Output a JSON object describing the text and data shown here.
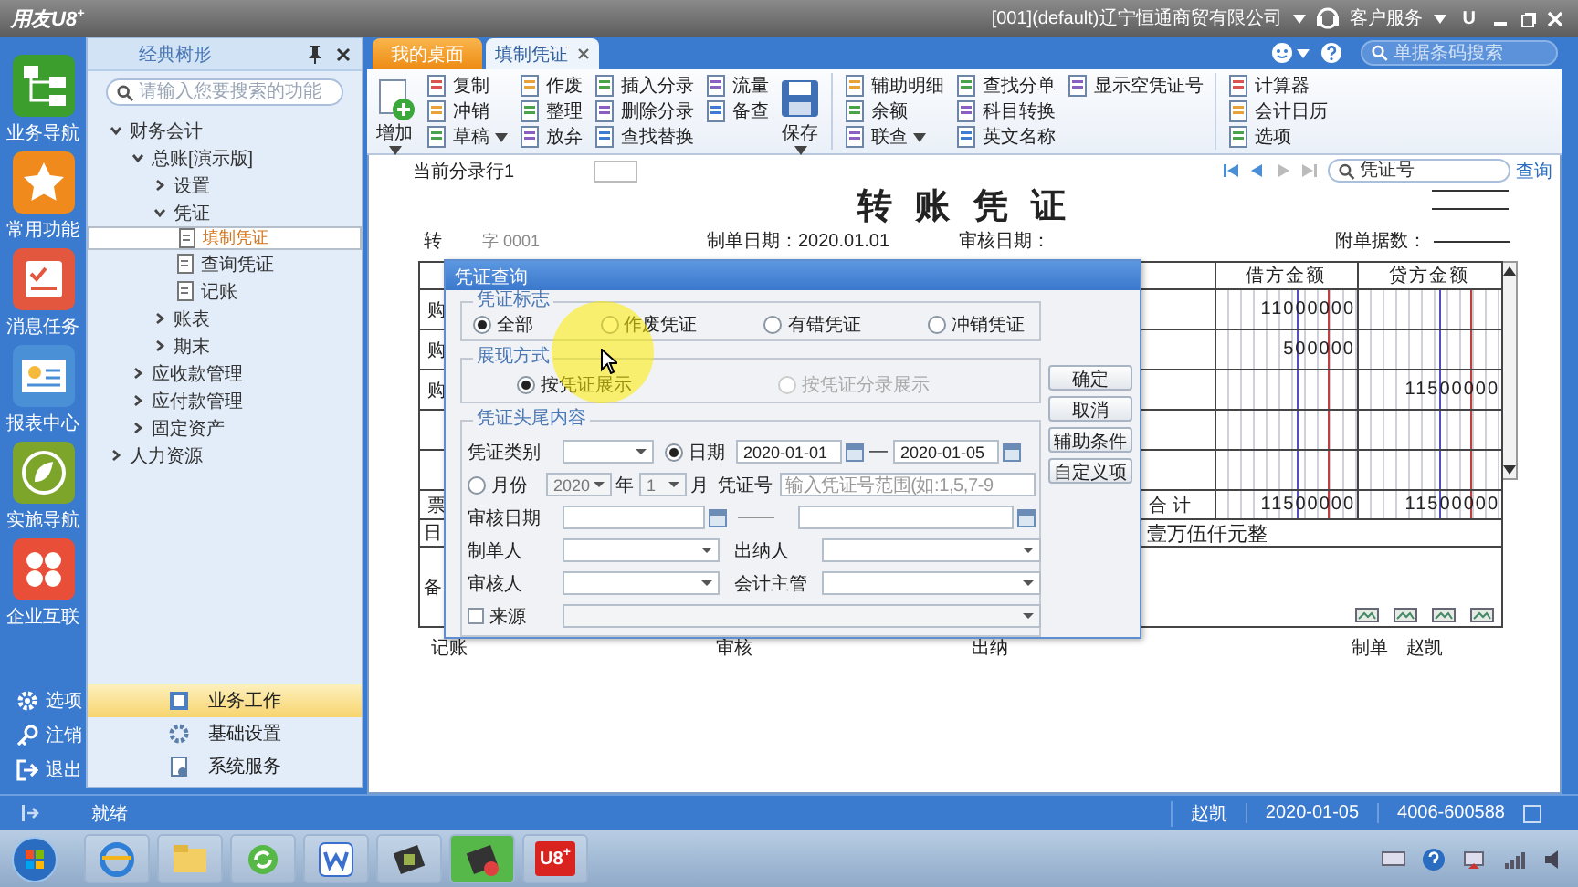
{
  "title_bar": {
    "app_name": "用友U8$^{+}$",
    "company": "[001](default)辽宁恒通商贸有限公司",
    "service": "客户服务",
    "letter_button": "U"
  },
  "nav": [
    {
      "label": "业务导航",
      "color": "#3c9e2c"
    },
    {
      "label": "常用功能",
      "color": "#f08a1c"
    },
    {
      "label": "消息任务",
      "color": "#e2573e"
    },
    {
      "label": "报表中心",
      "color": "#4a90d6"
    },
    {
      "label": "实施导航",
      "color": "#7da52a"
    },
    {
      "label": "企业互联",
      "color": "#e84e38"
    }
  ],
  "nav_bottom": [
    "选项",
    "注销",
    "退出"
  ],
  "tree_panel": {
    "title": "经典树形",
    "search_placeholder": "请输入您要搜索的功能",
    "tree": [
      {
        "label": "财务会计",
        "expanded": true,
        "children": [
          {
            "label": "总账[演示版]",
            "expanded": true,
            "children": [
              {
                "label": "设置",
                "expanded": false
              },
              {
                "label": "凭证",
                "expanded": true,
                "children": [
                  {
                    "label": "填制凭证",
                    "kind": "doc",
                    "selected": true
                  },
                  {
                    "label": "查询凭证",
                    "kind": "doc",
                    "selected": false
                  },
                  {
                    "label": "记账",
                    "kind": "doc",
                    "selected": false
                  }
                ]
              },
              {
                "label": "账表",
                "expanded": false
              },
              {
                "label": "期末",
                "expanded": false
              }
            ]
          },
          {
            "label": "应收款管理",
            "expanded": false
          },
          {
            "label": "应付款管理",
            "expanded": false
          },
          {
            "label": "固定资产",
            "expanded": false
          }
        ]
      },
      {
        "label": "人力资源",
        "expanded": false
      }
    ],
    "modules": [
      {
        "label": "业务工作",
        "selected": true
      },
      {
        "label": "基础设置",
        "selected": false
      },
      {
        "label": "系统服务",
        "selected": false
      }
    ]
  },
  "tabs": [
    {
      "label": "我的桌面",
      "selected": false,
      "closable": false
    },
    {
      "label": "填制凭证",
      "selected": true,
      "closable": true
    }
  ],
  "search_placeholder": "单据条码搜索",
  "toolbar": [
    {
      "kind": "large",
      "items": [
        {
          "label": "增加",
          "menu": true
        }
      ]
    },
    {
      "kind": "stack",
      "items": [
        {
          "label": "复制",
          "menu": false
        },
        {
          "label": "冲销",
          "menu": false
        },
        {
          "label": "草稿",
          "menu": true
        }
      ]
    },
    {
      "kind": "stack",
      "items": [
        {
          "label": "作废",
          "menu": false
        },
        {
          "label": "整理",
          "menu": false
        },
        {
          "label": "放弃",
          "menu": false
        }
      ]
    },
    {
      "kind": "stack",
      "items": [
        {
          "label": "插入分录",
          "menu": false
        },
        {
          "label": "删除分录",
          "menu": false
        },
        {
          "label": "查找替换",
          "menu": false
        }
      ]
    },
    {
      "kind": "stack",
      "items": [
        {
          "label": "流量",
          "menu": false
        },
        {
          "label": "备查",
          "menu": false
        }
      ]
    },
    {
      "kind": "large",
      "items": [
        {
          "label": "保存",
          "menu": true
        }
      ]
    },
    {
      "kind": "separator"
    },
    {
      "kind": "stack",
      "items": [
        {
          "label": "辅助明细",
          "menu": false
        },
        {
          "label": "余额",
          "menu": false
        },
        {
          "label": "联查",
          "menu": true
        }
      ]
    },
    {
      "kind": "stack",
      "items": [
        {
          "label": "查找分单",
          "menu": false
        },
        {
          "label": "科目转换",
          "menu": false
        },
        {
          "label": "英文名称",
          "menu": false
        }
      ]
    },
    {
      "kind": "stack",
      "items": [
        {
          "label": "显示空凭证号",
          "menu": false
        }
      ]
    },
    {
      "kind": "separator"
    },
    {
      "kind": "stack",
      "items": [
        {
          "label": "计算器",
          "menu": false
        },
        {
          "label": "会计日历",
          "menu": false
        },
        {
          "label": "选项",
          "menu": false
        }
      ]
    }
  ],
  "voucher": {
    "current_row": "当前分录行1",
    "search_placeholder": "凭证号",
    "query": "查询",
    "title": "转 账 凭 证",
    "head": {
      "type": "转",
      "number": "字 0001",
      "date": "制单日期：2020.01.01",
      "audit_date": "审核日期：",
      "attachments": "附单据数："
    },
    "columns": [
      "借方金额",
      "贷方金额"
    ],
    "rows": [
      {
        "summary": "购",
        "debit": "11000000",
        "credit": ""
      },
      {
        "summary": "购",
        "debit": "500000",
        "credit": ""
      },
      {
        "summary": "购",
        "debit": "",
        "credit": "11500000"
      }
    ],
    "ticket": "票",
    "date": "日",
    "total_label": "合 计",
    "total_debit": "11500000",
    "total_credit": "11500000",
    "amount_words": "壹万伍仟元整",
    "note": "备",
    "footer": [
      "记账",
      "审核",
      "出纳",
      "制单",
      "赵凯"
    ]
  },
  "dialog": {
    "title": "凭证查询",
    "flag_group": {
      "legend": "凭证标志",
      "options": [
        {
          "label": "全部",
          "selected": true
        },
        {
          "label": "作废凭证",
          "selected": false
        },
        {
          "label": "有错凭证",
          "selected": false
        },
        {
          "label": "冲销凭证",
          "selected": false
        }
      ]
    },
    "display_group": {
      "legend": "展现方式",
      "options": [
        {
          "label": "按凭证展示",
          "selected": true,
          "disabled": false
        },
        {
          "label": "按凭证分录展示",
          "selected": false,
          "disabled": true
        }
      ]
    },
    "header_group": {
      "legend": "凭证头尾内容",
      "voucher_type_label": "凭证类别",
      "date_mode": {
        "label": "日期",
        "selected": true
      },
      "date_from": "2020-01-01",
      "date_sep": "—",
      "date_to": "2020-01-05",
      "month_mode": {
        "label": "月份",
        "selected": false
      },
      "year": "2020",
      "year_label": "年",
      "month": "1",
      "month_label": "月",
      "voucher_no_label": "凭证号",
      "voucher_no_placeholder": "输入凭证号范围(如:1,5,7-9",
      "voucher_no_sep": "——",
      "audit_date_label": "审核日期",
      "maker_label": "制单人",
      "cashier_label": "出纳人",
      "auditor_label": "审核人",
      "supervisor_label": "会计主管",
      "source": {
        "label": "来源",
        "checked": false
      }
    },
    "buttons": [
      "确定",
      "取消",
      "辅助条件",
      "自定义项"
    ]
  },
  "status_bar": {
    "status": "就绪",
    "user": "赵凯",
    "date": "2020-01-05",
    "phone": "4006-600588"
  },
  "taskbar": {
    "app_label": "U8$^{+}$"
  }
}
